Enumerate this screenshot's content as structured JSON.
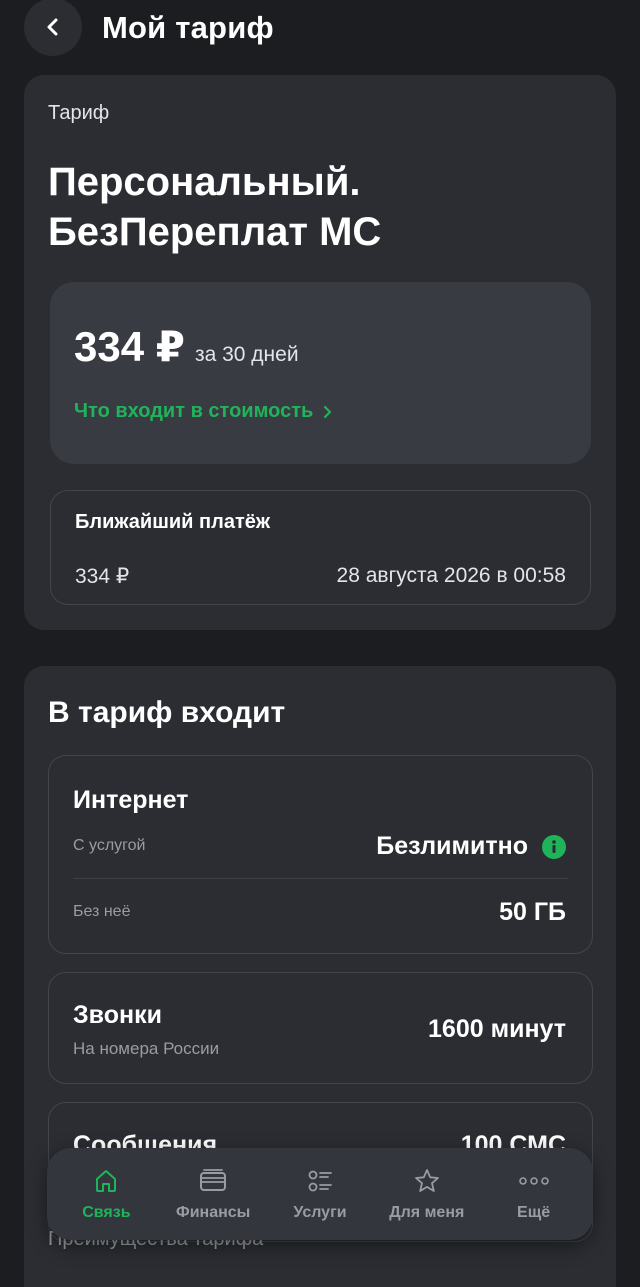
{
  "header": {
    "title": "Мой тариф"
  },
  "tariff": {
    "label": "Тариф",
    "name": "Персональный. БезПереплат МС",
    "price": "334 ₽",
    "period": "за 30 дней",
    "details_link": "Что входит в стоимость"
  },
  "payment": {
    "title": "Ближайший платёж",
    "amount": "334 ₽",
    "date": "28 августа 2026 в 00:58"
  },
  "includes": {
    "title": "В тариф входит",
    "internet": {
      "title": "Интернет",
      "with_service_label": "С услугой",
      "with_service_value": "Безлимитно",
      "without_service_label": "Без неё",
      "without_service_value": "50 ГБ"
    },
    "calls": {
      "title": "Звонки",
      "subtitle": "На номера России",
      "value": "1600 минут"
    },
    "sms": {
      "title": "Сообщения",
      "value": "100 СМС"
    },
    "advantages": "Преимущества тарифа"
  },
  "nav": {
    "items": [
      {
        "label": "Связь",
        "icon": "home-icon",
        "active": true
      },
      {
        "label": "Финансы",
        "icon": "wallet-icon",
        "active": false
      },
      {
        "label": "Услуги",
        "icon": "services-icon",
        "active": false
      },
      {
        "label": "Для меня",
        "icon": "star-icon",
        "active": false
      },
      {
        "label": "Ещё",
        "icon": "more-icon",
        "active": false
      }
    ]
  },
  "colors": {
    "background": "#1c1d21",
    "card": "#2b2d33",
    "accent_green": "#1fb35a",
    "muted_text": "#9a9ca3"
  }
}
